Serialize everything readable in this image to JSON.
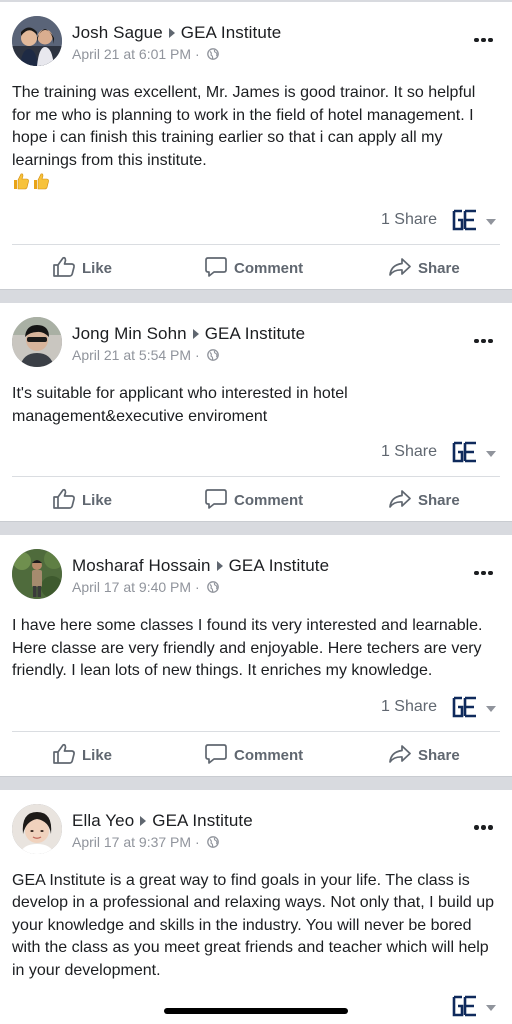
{
  "posts": [
    {
      "author": "Josh Sague",
      "target": "GEA Institute",
      "timestamp": "April 21 at 6:01 PM",
      "body": "The training was excellent, Mr. James is good trainor. It so helpful for me who is planning to work in the field of hotel management. I hope i can finish this training earlier so that i can apply all my learnings from this institute.",
      "reaction_emoji": [
        "thumbs-up-emoji",
        "thumbs-up-emoji"
      ],
      "share_count": "1 Share"
    },
    {
      "author": "Jong Min Sohn",
      "target": "GEA Institute",
      "timestamp": "April 21 at 5:54 PM",
      "body": "It's suitable for applicant who interested in hotel management&executive enviroment",
      "share_count": "1 Share"
    },
    {
      "author": "Mosharaf Hossain",
      "target": "GEA Institute",
      "timestamp": "April 17 at 9:40 PM",
      "body": "I have here some classes I found its very interested and learnable. Here classe are very friendly and enjoyable. Here techers are very friendly. I lean lots of new things. It enriches my knowledge.",
      "share_count": "1 Share"
    },
    {
      "author": "Ella Yeo",
      "target": "GEA Institute",
      "timestamp": "April 17 at 9:37 PM",
      "body": "GEA Institute is a great way to find goals in your life. The class is develop in a professional and relaxing ways. Not only that, I build up your knowledge and skills in the industry. You will never be bored with the class as you meet great friends and teacher which will help in your development."
    }
  ],
  "actions": {
    "like": "Like",
    "comment": "Comment",
    "share": "Share"
  },
  "meta_separator": " · ",
  "colors": {
    "page_bg": "#d8dadf",
    "card_bg": "#ffffff",
    "text": "#1c1e21",
    "muted": "#90949c",
    "action": "#606770",
    "brand_icon": "#0f2a5c"
  },
  "icons": [
    "more-options-icon",
    "globe-icon",
    "like-icon",
    "comment-icon",
    "share-icon",
    "page-logo-icon",
    "caret-down-icon"
  ]
}
